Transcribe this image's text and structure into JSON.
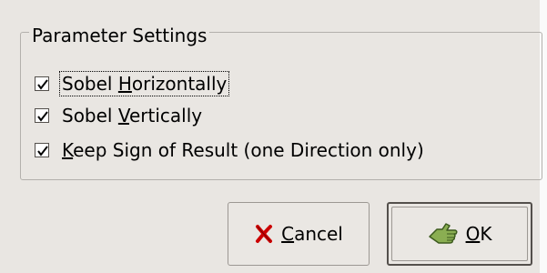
{
  "frame": {
    "title": "Parameter Settings"
  },
  "checkboxes": [
    {
      "pre": "Sobel ",
      "mnemonic": "H",
      "post": "orizontally",
      "checked": true,
      "focused": true
    },
    {
      "pre": "Sobel ",
      "mnemonic": "V",
      "post": "ertically",
      "checked": true,
      "focused": false
    },
    {
      "pre": "",
      "mnemonic": "K",
      "post": "eep Sign of Result (one Direction only)",
      "checked": true,
      "focused": false
    }
  ],
  "buttons": {
    "cancel": {
      "mnemonic": "C",
      "rest": "ancel",
      "icon": "cancel-x-icon"
    },
    "ok": {
      "mnemonic": "O",
      "rest": "K",
      "icon": "ok-hand-icon"
    }
  },
  "colors": {
    "dialog_bg": "#e9e6e2",
    "cancel_icon": "#cc0000",
    "ok_icon": "#6b8e3a"
  }
}
